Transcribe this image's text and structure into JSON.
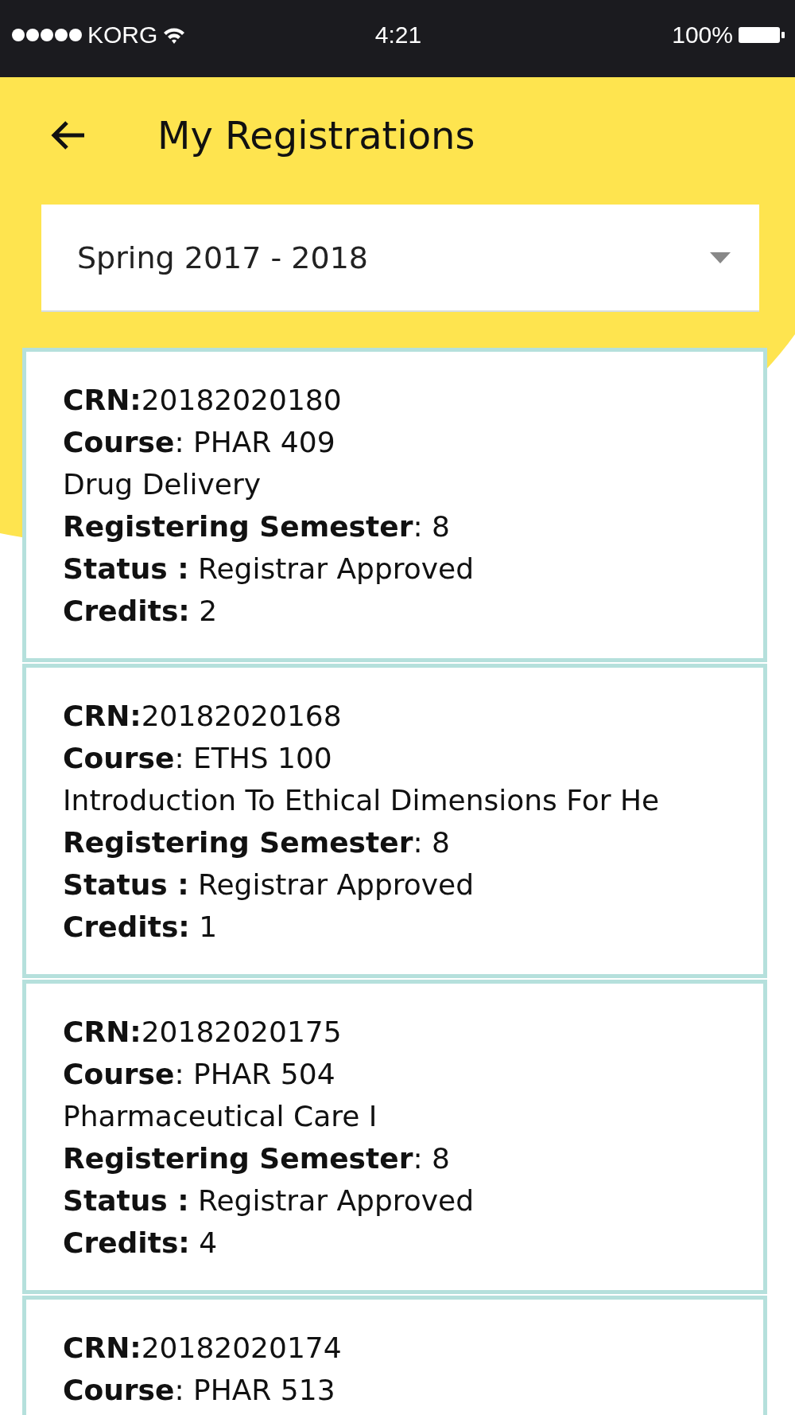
{
  "status_bar": {
    "carrier": "KORG",
    "time": "4:21",
    "battery": "100%"
  },
  "header": {
    "title": "My Registrations"
  },
  "semester_dropdown": {
    "value": "Spring 2017 - 2018"
  },
  "registrations": [
    {
      "lines": [
        "**CRN:**20182020180",
        "**Course**: PHAR 409",
        "Drug Delivery",
        "**Registering Semester**: 8",
        "**Status :** Registrar Approved",
        "**Credits:** 2"
      ]
    },
    {
      "lines": [
        "**CRN:**20182020168",
        "**Course**: ETHS 100",
        "Introduction To Ethical Dimensions For He",
        "**Registering Semester**: 8",
        "**Status :** Registrar Approved",
        "**Credits:** 1"
      ]
    },
    {
      "lines": [
        "**CRN:**20182020175",
        "**Course**: PHAR 504",
        "Pharmaceutical Care I",
        "**Registering Semester**: 8",
        "**Status :** Registrar Approved",
        "**Credits:** 4"
      ]
    },
    {
      "lines": [
        "**CRN:**20182020174",
        "**Course**: PHAR 513"
      ]
    }
  ]
}
